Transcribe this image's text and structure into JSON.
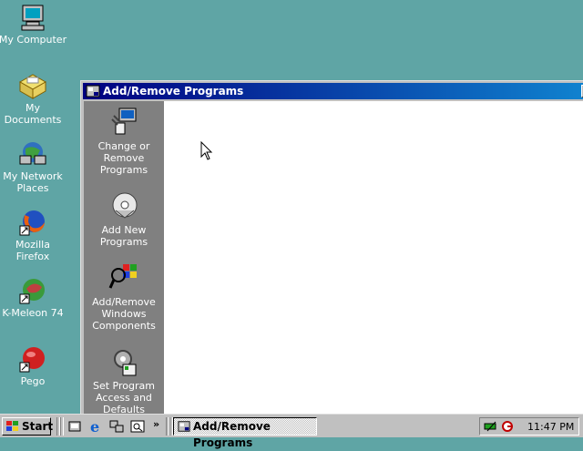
{
  "desktop": {
    "icons": [
      {
        "label": "My Computer"
      },
      {
        "label": "My Documents"
      },
      {
        "label": "My Network Places"
      },
      {
        "label": "Mozilla Firefox"
      },
      {
        "label": "K-Meleon 74"
      },
      {
        "label": "Pego"
      }
    ]
  },
  "window": {
    "title": "Add/Remove Programs",
    "sidebar": [
      {
        "label": "Change or Remove Programs"
      },
      {
        "label": "Add New Programs"
      },
      {
        "label": "Add/Remove Windows Components"
      },
      {
        "label": "Set Program Access and Defaults"
      }
    ]
  },
  "taskbar": {
    "start_label": "Start",
    "overflow_label": "»",
    "task_label": "Add/Remove Programs",
    "clock": "11:47 PM"
  },
  "colors": {
    "desktop": "#5fa5a5",
    "titlebar_start": "#000080",
    "titlebar_end": "#1084d0",
    "sidebar": "#808080"
  }
}
